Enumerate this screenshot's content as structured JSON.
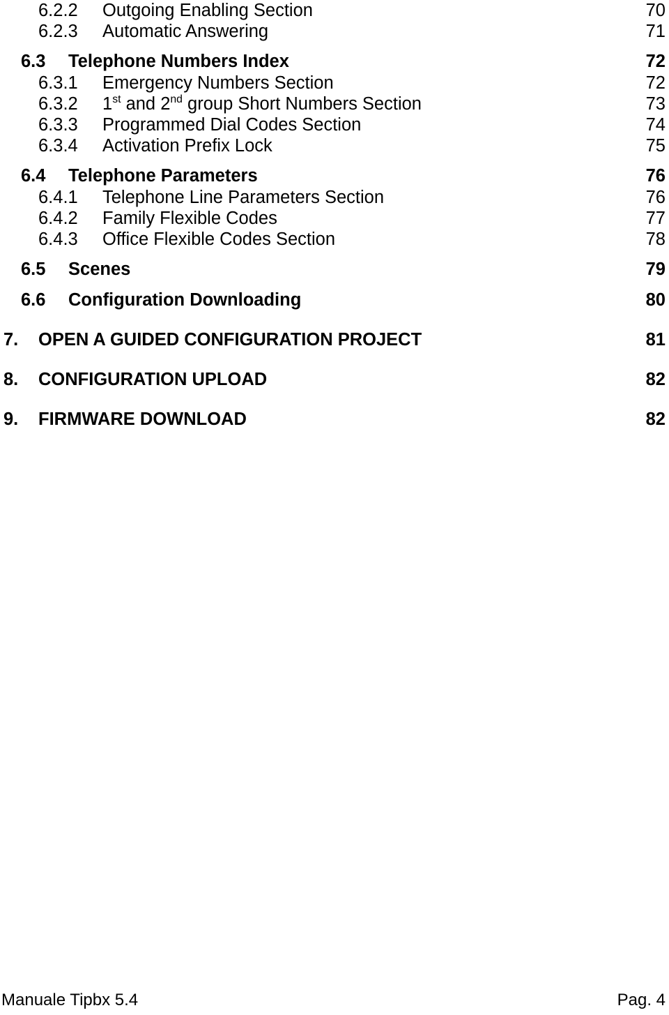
{
  "document": {
    "type": "table-of-contents"
  },
  "toc": {
    "entries": [
      {
        "level": 3,
        "number": "6.2.2",
        "title": "Outgoing Enabling Section",
        "page": "70"
      },
      {
        "level": 3,
        "number": "6.2.3",
        "title": "Automatic Answering",
        "page": "71"
      },
      {
        "level": 2,
        "number": "6.3",
        "title": "Telephone Numbers Index",
        "page": "72"
      },
      {
        "level": 3,
        "number": "6.3.1",
        "title": "Emergency Numbers Section",
        "page": "72"
      },
      {
        "level": 3,
        "number": "6.3.2",
        "title": "1st and 2nd group Short Numbers Section",
        "title_parts": [
          {
            "text": "1"
          },
          {
            "text": "st",
            "sup": true
          },
          {
            "text": " and 2"
          },
          {
            "text": "nd",
            "sup": true
          },
          {
            "text": " group Short Numbers Section"
          }
        ],
        "page": "73"
      },
      {
        "level": 3,
        "number": "6.3.3",
        "title": "Programmed Dial Codes Section",
        "page": "74"
      },
      {
        "level": 3,
        "number": "6.3.4",
        "title": "Activation Prefix Lock",
        "page": "75"
      },
      {
        "level": 2,
        "number": "6.4",
        "title": "Telephone Parameters",
        "page": "76"
      },
      {
        "level": 3,
        "number": "6.4.1",
        "title": "Telephone Line Parameters Section",
        "page": "76"
      },
      {
        "level": 3,
        "number": "6.4.2",
        "title": "Family Flexible Codes",
        "page": "77"
      },
      {
        "level": 3,
        "number": "6.4.3",
        "title": "Office Flexible Codes Section",
        "page": "78"
      },
      {
        "level": 2,
        "number": "6.5",
        "title": "Scenes",
        "page": "79"
      },
      {
        "level": 2,
        "number": "6.6",
        "title": "Configuration Downloading",
        "page": "80"
      },
      {
        "level": 1,
        "number": "7.",
        "title": "OPEN A GUIDED CONFIGURATION PROJECT",
        "page": "81"
      },
      {
        "level": 1,
        "number": "8.",
        "title": "CONFIGURATION UPLOAD",
        "page": "82"
      },
      {
        "level": 1,
        "number": "9.",
        "title": "FIRMWARE DOWNLOAD",
        "page": "82"
      }
    ]
  },
  "footer": {
    "left": "Manuale Tipbx 5.4",
    "right": "Pag. 4"
  }
}
